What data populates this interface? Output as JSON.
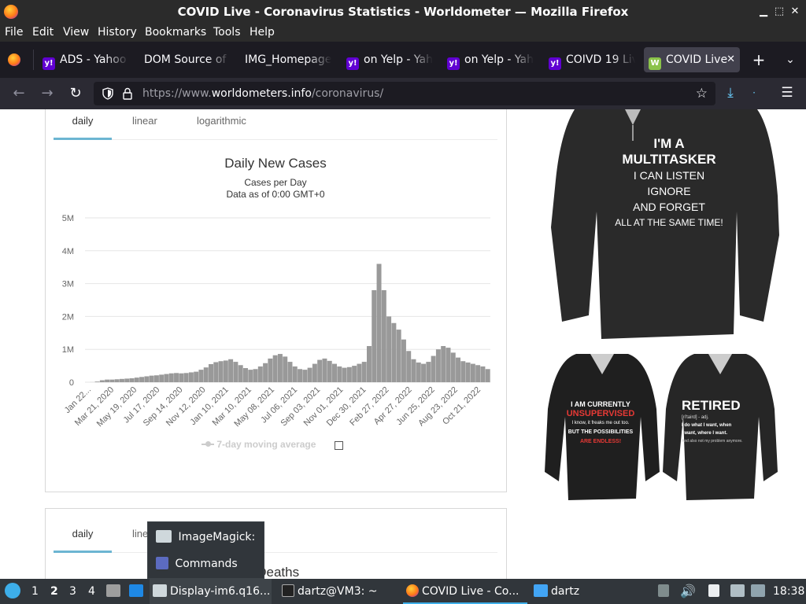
{
  "window": {
    "title": "COVID Live - Coronavirus Statistics - Worldometer — Mozilla Firefox"
  },
  "menu": [
    "File",
    "Edit",
    "View",
    "History",
    "Bookmarks",
    "Tools",
    "Help"
  ],
  "tabs": [
    {
      "label": "ADS - Yahoo",
      "icon": "yahoo-icon",
      "color": "#6001d2"
    },
    {
      "label": "DOM Source of",
      "icon": "none",
      "color": ""
    },
    {
      "label": "IMG_Homepage",
      "icon": "none",
      "color": ""
    },
    {
      "label": "on Yelp - Yah",
      "icon": "yahoo-icon",
      "color": "#6001d2"
    },
    {
      "label": "on Yelp - Yah",
      "icon": "yahoo-icon",
      "color": "#6001d2"
    },
    {
      "label": "COIVD 19 Liv",
      "icon": "yahoo-icon",
      "color": "#6001d2"
    },
    {
      "label": "COVID Live",
      "icon": "worldometer-icon",
      "color": "#8bc34a",
      "active": true
    }
  ],
  "navbar": {
    "url_prefix": "https://www.",
    "url_domain": "worldometers.info",
    "url_path": "/coronavirus/"
  },
  "card1": {
    "tabs": [
      "daily",
      "linear",
      "logarithmic"
    ],
    "selected_tab": "daily",
    "legend_label": "7-day moving average"
  },
  "card2": {
    "tabs": [
      "daily",
      "linear"
    ],
    "selected_tab": "daily",
    "title_fragment": "y Deaths"
  },
  "chart_data": {
    "type": "bar",
    "title": "Daily New Cases",
    "subtitle": "Cases per Day",
    "subtitle2": "Data as of 0:00 GMT+0",
    "ylim": [
      0,
      5000000
    ],
    "yticks": [
      "0",
      "1M",
      "2M",
      "3M",
      "4M",
      "5M"
    ],
    "xticks": [
      "Jan 22...",
      "Mar 21, 2020",
      "May 19, 2020",
      "Jul 17, 2020",
      "Sep 14, 2020",
      "Nov 12, 2020",
      "Jan 10, 2021",
      "Mar 10, 2021",
      "May 08, 2021",
      "Jul 06, 2021",
      "Sep 03, 2021",
      "Nov 01, 2021",
      "Dec 30, 2021",
      "Feb 27, 2022",
      "Apr 27, 2022",
      "Jun 25, 2022",
      "Aug 23, 2022",
      "Oct 21, 2022"
    ],
    "grid": true,
    "legend": "bottom",
    "weekly_values": [
      0,
      2000,
      20000,
      60000,
      80000,
      80000,
      90000,
      100000,
      110000,
      120000,
      140000,
      160000,
      180000,
      200000,
      210000,
      230000,
      250000,
      270000,
      280000,
      270000,
      280000,
      300000,
      320000,
      380000,
      450000,
      550000,
      610000,
      640000,
      660000,
      700000,
      620000,
      520000,
      430000,
      380000,
      400000,
      480000,
      580000,
      720000,
      820000,
      860000,
      780000,
      620000,
      480000,
      400000,
      380000,
      440000,
      560000,
      680000,
      720000,
      650000,
      560000,
      480000,
      440000,
      460000,
      500000,
      560000,
      620000,
      1100000,
      2800000,
      3600000,
      2800000,
      2000000,
      1800000,
      1600000,
      1300000,
      950000,
      700000,
      600000,
      560000,
      620000,
      800000,
      1000000,
      1100000,
      1050000,
      900000,
      750000,
      640000,
      600000,
      560000,
      520000,
      480000,
      400000
    ]
  },
  "taskbar": {
    "workspaces": [
      "1",
      "2",
      "3",
      "4"
    ],
    "tasks": [
      {
        "label": "Display-im6.q16...",
        "icon": "window-icon"
      },
      {
        "label": "dartz@VM3: ~",
        "icon": "terminal-icon"
      },
      {
        "label": "COVID Live - Co...",
        "icon": "firefox-icon"
      },
      {
        "label": "dartz",
        "icon": "folder-icon"
      }
    ],
    "clock": "18:38"
  },
  "popup": {
    "items": [
      "ImageMagick:",
      "Commands"
    ]
  },
  "ads": {
    "shirt1": [
      "I'M A",
      "MULTITASKER",
      "I CAN LISTEN",
      "IGNORE",
      "AND FORGET",
      "ALL AT THE SAME TIME!"
    ],
    "shirt2": [
      "I AM CURRENTLY",
      "UNSUPERVISED",
      "I know, it freaks me out too.",
      "BUT THE POSSIBILITIES",
      "ARE ENDLESS!"
    ],
    "shirt3": [
      "RETIRED",
      "[ri'taird] - adj.",
      "I do what I want, when",
      "I want, where I want.",
      "And also not my problem anymore."
    ]
  },
  "colors": {
    "bar": "#999999",
    "selected_tab_underline": "#6cb5d2"
  }
}
